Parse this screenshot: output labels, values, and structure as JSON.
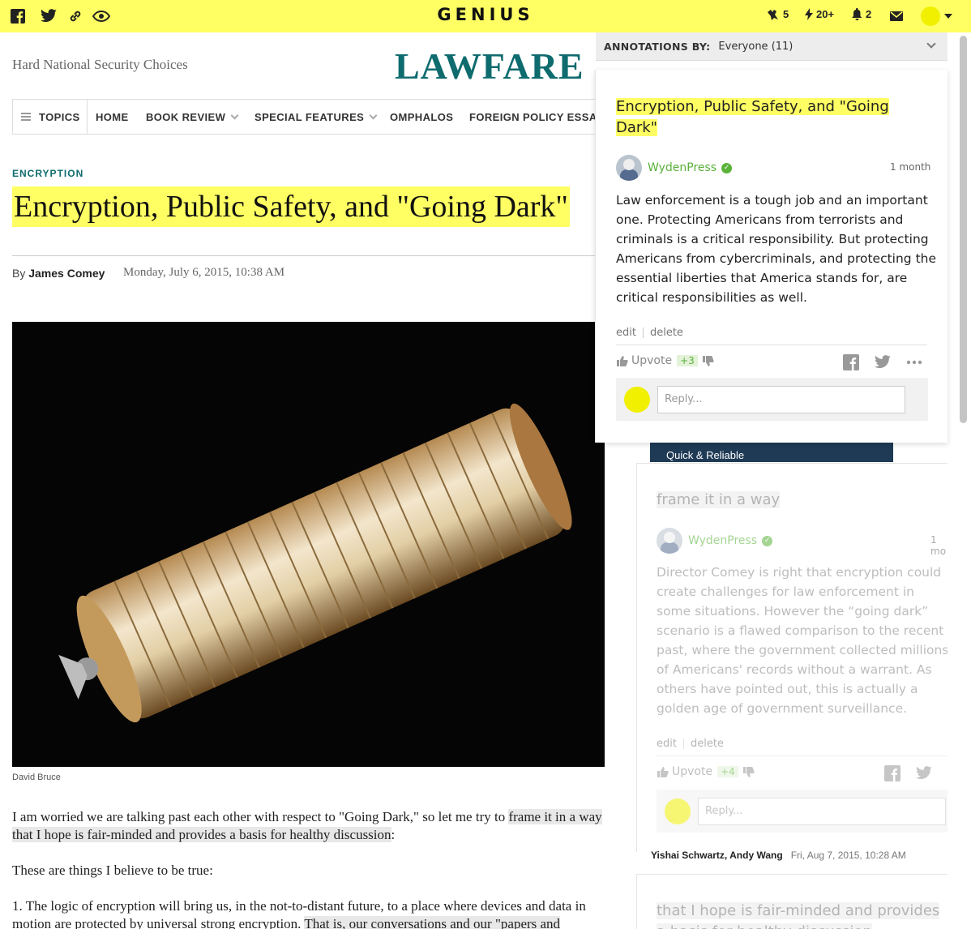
{
  "topbar": {
    "logo": "GENIUS",
    "icons": [
      "facebook-icon",
      "twitter-icon",
      "link-icon",
      "eye-icon"
    ],
    "stats": {
      "iq": "5",
      "activity": "20+",
      "notifications": "2"
    },
    "accent": "#ffff64"
  },
  "page": {
    "tagline": "Hard National Security Choices",
    "brand": "LAWFARE",
    "nav": [
      {
        "label": "TOPICS"
      },
      {
        "label": "HOME"
      },
      {
        "label": "BOOK REVIEW"
      },
      {
        "label": "SPECIAL FEATURES"
      },
      {
        "label": "OMPHALOS"
      },
      {
        "label": "FOREIGN POLICY ESSAY"
      }
    ],
    "category": "ENCRYPTION",
    "headline": "Encryption, Public Safety, and \"Going Dark\"",
    "by": "By",
    "author": "James Comey",
    "date": "Monday, July 6, 2015, 10:38 AM",
    "photo_credit": "David Bruce",
    "p1_pre": "I am worried we are talking past each other with respect to \"Going Dark,\" so let me try to ",
    "p1_hl1": "frame it in a way",
    "p1_hl2": "that I hope is fair-minded and provides a basis for healthy discussion",
    "p1_post": ":",
    "p2": "These are things I believe to be true:",
    "p3_pre": "1. The logic of encryption will bring us, in the not-to-distant future, to a place where devices and data in motion are protected by universal strong encryption. ",
    "p3_hl": "That is, our conversations and our \"papers and"
  },
  "panel": {
    "header_label": "ANNOTATIONS BY:",
    "header_value": "Everyone (11)",
    "annotations": [
      {
        "title": "Encryption, Public Safety, and \"Going Dark\"",
        "user": "WydenPress",
        "age": "1 month",
        "body": "Law enforcement is a tough job and an important one. Protecting Americans from terrorists and criminals is a critical responsibility. But protecting Americans from cybercriminals, and protecting the essential liberties that America stands for, are critical responsibilities as well.",
        "edit": "edit",
        "delete": "delete",
        "upvote": "Upvote",
        "votes": "+3",
        "reply_placeholder": "Reply..."
      },
      {
        "title": "frame it in a way",
        "user": "WydenPress",
        "age": "1 mo",
        "body": "Director Comey is right that encryption could create challenges for law enforcement in some situations. However the “going dark” scenario is a flawed comparison to the recent past, where the government collected millions of Americans' records without a warrant. As others have pointed out, this is actually a golden age of government surveillance.",
        "edit": "edit",
        "delete": "delete",
        "upvote": "Upvote",
        "votes": "+4",
        "reply_placeholder": "Reply..."
      },
      {
        "title": "that I hope is fair-minded and provides a basis for healthy discussion"
      }
    ],
    "ad_text": "Quick & Reliable",
    "related_authors": "Yishai Schwartz, Andy Wang",
    "related_date": "Fri, Aug 7, 2015, 10:28 AM"
  }
}
